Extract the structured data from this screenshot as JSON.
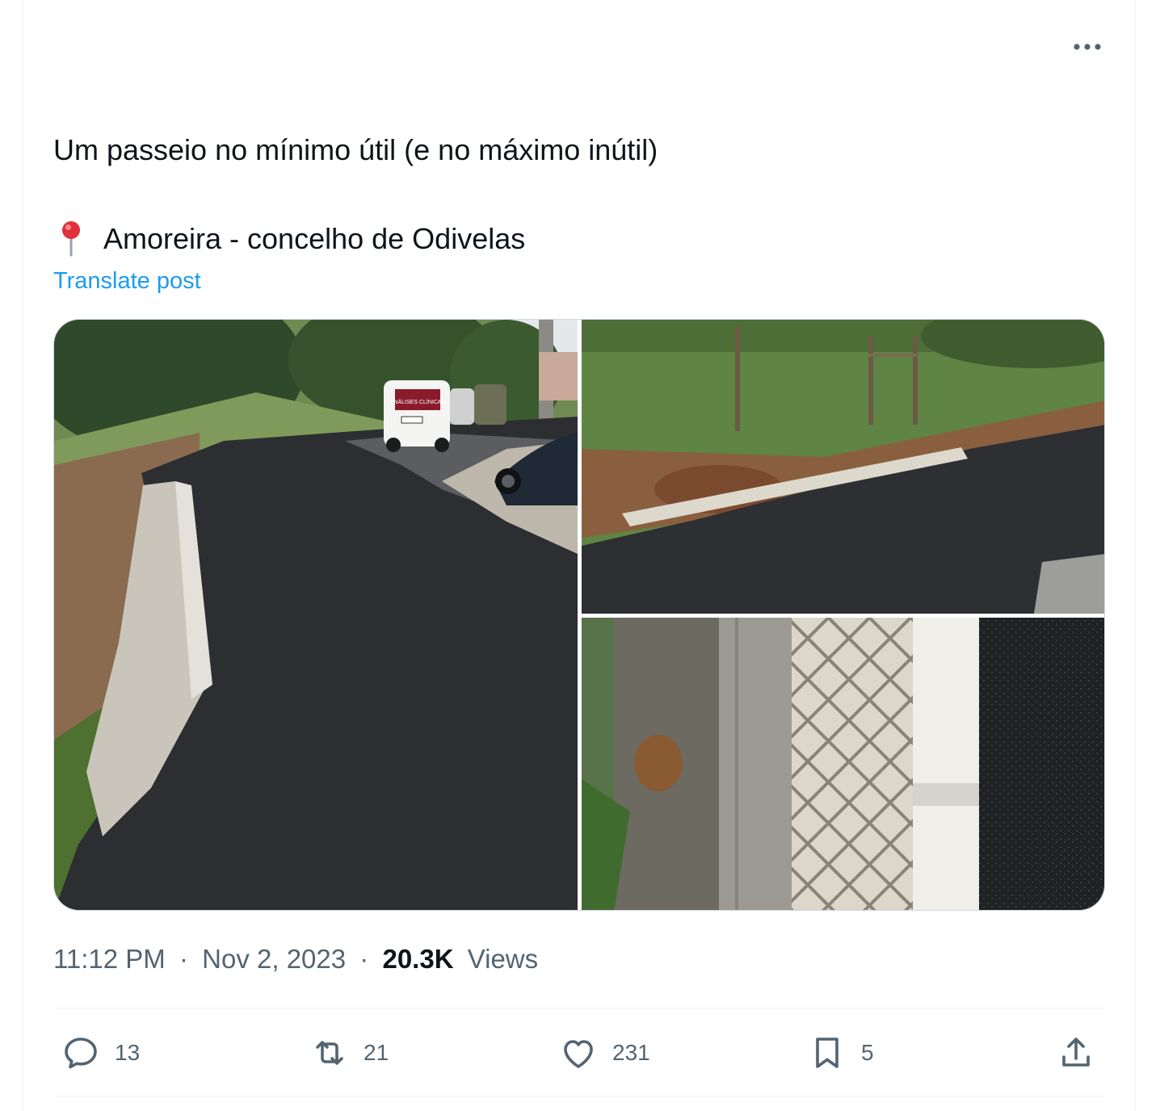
{
  "post": {
    "text_line1": "Um passeio no mínimo útil (e no máximo inútil)",
    "text_line2": "Amoreira - concelho de Odivelas",
    "location_icon": "round-pushpin-icon",
    "translate_label": "Translate post"
  },
  "meta": {
    "time": "11:12 PM",
    "separator": "·",
    "date": "Nov 2, 2023",
    "views_count": "20.3K",
    "views_label": "Views"
  },
  "actions": {
    "reply_count": "13",
    "retweet_count": "21",
    "like_count": "231",
    "bookmark_count": "5"
  },
  "colors": {
    "link": "#1d9bf0",
    "secondary_text": "#536471",
    "primary_text": "#0f1419",
    "border": "#eff3f4"
  },
  "media": {
    "photo_count": 3,
    "van_sign_text": "ANÁLISES CLÍNICAS"
  }
}
